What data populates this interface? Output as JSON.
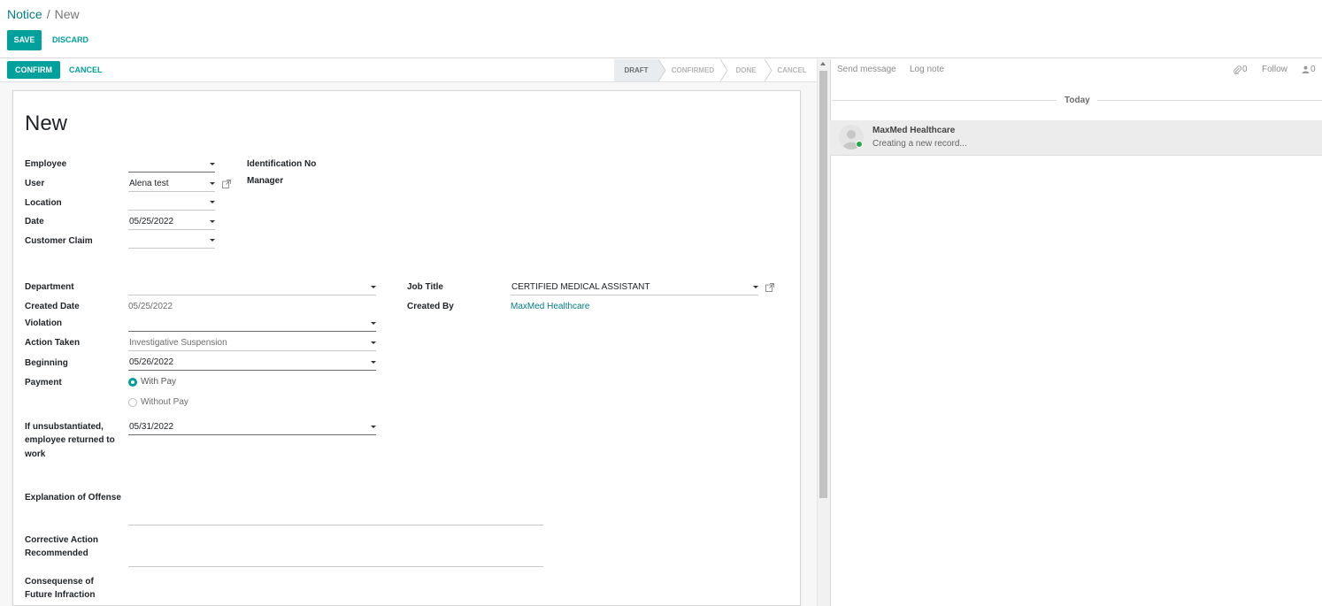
{
  "breadcrumb": {
    "parent": "Notice",
    "separator": "/",
    "current": "New"
  },
  "actions": {
    "save": "SAVE",
    "discard": "DISCARD",
    "confirm": "CONFIRM",
    "cancel": "CANCEL"
  },
  "stages": [
    {
      "label": "DRAFT",
      "active": true
    },
    {
      "label": "CONFIRMED",
      "active": false
    },
    {
      "label": "DONE",
      "active": false
    },
    {
      "label": "CANCEL",
      "active": false
    }
  ],
  "form": {
    "title": "New",
    "employee": {
      "label": "Employee",
      "value": ""
    },
    "user": {
      "label": "User",
      "value": "Alena test"
    },
    "location": {
      "label": "Location",
      "value": ""
    },
    "date": {
      "label": "Date",
      "value": "05/25/2022"
    },
    "customer_claim": {
      "label": "Customer Claim",
      "value": ""
    },
    "identification_no": {
      "label": "Identification No"
    },
    "manager": {
      "label": "Manager"
    },
    "department": {
      "label": "Department",
      "value": ""
    },
    "created_date": {
      "label": "Created Date",
      "value": "05/25/2022"
    },
    "violation": {
      "label": "Violation",
      "value": ""
    },
    "action_taken": {
      "label": "Action Taken",
      "value": "Investigative Suspension"
    },
    "beginning": {
      "label": "Beginning",
      "value": "05/26/2022"
    },
    "payment": {
      "label": "Payment",
      "options": [
        {
          "label": "With Pay",
          "selected": true
        },
        {
          "label": "Without Pay",
          "selected": false
        }
      ]
    },
    "returned": {
      "label_lines": [
        "If unsubstantiated,",
        "employee returned to",
        "work"
      ],
      "value": "05/31/2022"
    },
    "job_title": {
      "label": "Job Title",
      "value": "CERTIFIED MEDICAL ASSISTANT"
    },
    "created_by": {
      "label": "Created By",
      "value": "MaxMed Healthcare"
    },
    "explanation": {
      "label": "Explanation of Offense"
    },
    "corrective": {
      "label_lines": [
        "Corrective Action",
        "Recommended"
      ]
    },
    "consequence": {
      "label_lines": [
        "Consequense of",
        "Future Infraction"
      ]
    }
  },
  "chatter": {
    "send_message": "Send message",
    "log_note": "Log note",
    "attachments_count": "0",
    "follow": "Follow",
    "followers_count": "0",
    "date_separator": "Today",
    "messages": [
      {
        "author": "MaxMed Healthcare",
        "body": "Creating a new record..."
      }
    ]
  },
  "colors": {
    "primary": "#00a09d",
    "link": "#017e84",
    "online": "#28a745"
  },
  "icons": [
    "external-link-icon",
    "paperclip-icon",
    "user-icon",
    "caret-down-icon",
    "avatar-icon"
  ]
}
